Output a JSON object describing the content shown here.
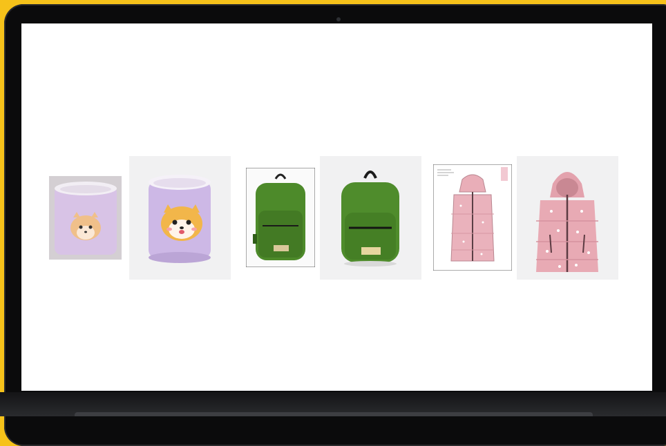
{
  "screen": {
    "background": "#ffffff",
    "products": [
      {
        "name": "plush-cup-sketch",
        "variant": "sample-photo"
      },
      {
        "name": "plush-cup",
        "variant": "product-photo"
      },
      {
        "name": "green-backpack-sketch",
        "variant": "sample-photo"
      },
      {
        "name": "green-backpack",
        "variant": "product-photo"
      },
      {
        "name": "pink-vest-techpack",
        "variant": "technical-drawing"
      },
      {
        "name": "pink-vest",
        "variant": "product-photo"
      }
    ]
  },
  "colors": {
    "frame": "#f6c21a",
    "bezel": "#0b0b0c",
    "plush_lavender": "#d9c5eb",
    "backpack_green": "#4d8a2a",
    "vest_pink": "#e8aab2"
  },
  "backpack_tag_label": "",
  "icons": [
    "camera-icon"
  ]
}
